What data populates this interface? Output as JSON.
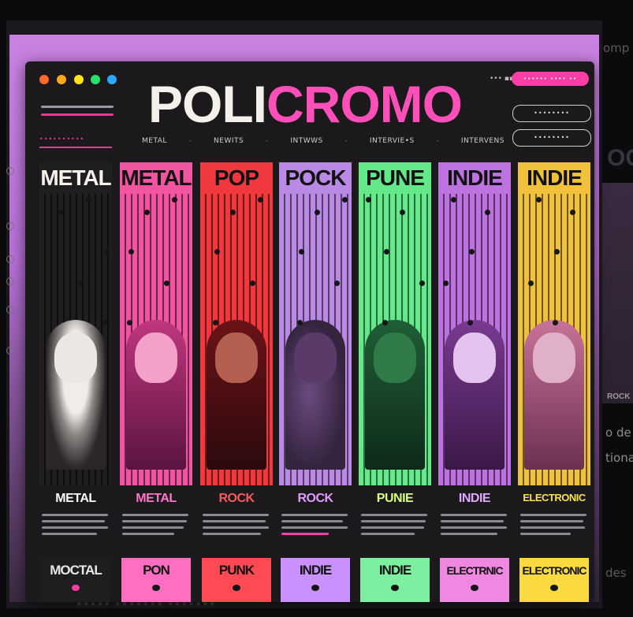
{
  "app": {
    "logo_part1": "POLI",
    "logo_part2": "CROMO",
    "signal_text": "••• ▪▪",
    "top_pill": "•••••• •••• ••",
    "button_1": "••••••••",
    "button_2": "••••••••",
    "side_tag": "••••••••••"
  },
  "nav": [
    "METAL",
    "NEWITS",
    "INTWWS",
    "INTERVIE•S",
    "INTERVENS"
  ],
  "colors": {
    "traffic": [
      "#ff6a2e",
      "#ffaa1e",
      "#ffe31f",
      "#2be06a",
      "#2ea8ff"
    ],
    "accent": "#ff3ea5"
  },
  "columns": [
    {
      "title": "METAL",
      "label": "METAL",
      "label_color": "#ffffff",
      "bg": "#1f1d20",
      "art": "skull",
      "tile": "MOCTAL",
      "tile_color": "#1f1d20",
      "tile_text_color": "#e8e8e8"
    },
    {
      "title": "METAL",
      "label": "METAL",
      "label_color": "#ff78c8",
      "bg": "#f2559f",
      "art": "band",
      "tile": "PON",
      "tile_color": "#ff6ec1"
    },
    {
      "title": "POP",
      "label": "ROCK",
      "label_color": "#ff5a5a",
      "bg": "#f0383e",
      "art": "duo",
      "tile": "PUNK",
      "tile_color": "#ff4a54"
    },
    {
      "title": "POCK",
      "label": "ROCK",
      "label_color": "#e39bff",
      "bg": "#b989e6",
      "art": "smoke",
      "tile": "INDIE",
      "tile_color": "#c991ff"
    },
    {
      "title": "PUNE",
      "label": "PUNIE",
      "label_color": "#d8ff7a",
      "bg": "#63e88a",
      "art": "portrait",
      "tile": "INDIE",
      "tile_color": "#7cf0a0"
    },
    {
      "title": "INDIE",
      "label": "INDIE",
      "label_color": "#e0a8ff",
      "bg": "#bc73e0",
      "art": "guitar",
      "tile": "ELECTRNIC",
      "tile_color": "#ef88e0"
    },
    {
      "title": "INDIE",
      "label": "ELECTRONIC",
      "label_color": "#f8e14e",
      "bg": "#f0c23b",
      "art": "face",
      "tile": "ELECTRONIC",
      "tile_color": "#fbd940"
    }
  ],
  "peek": {
    "title": "OC",
    "subtitle": "ROCK"
  },
  "background_text": {
    "right_1": "omp",
    "right_2": "o de",
    "right_3": "tiona",
    "right_4": "des",
    "bottom": "••••• ••••••• •••••••"
  }
}
